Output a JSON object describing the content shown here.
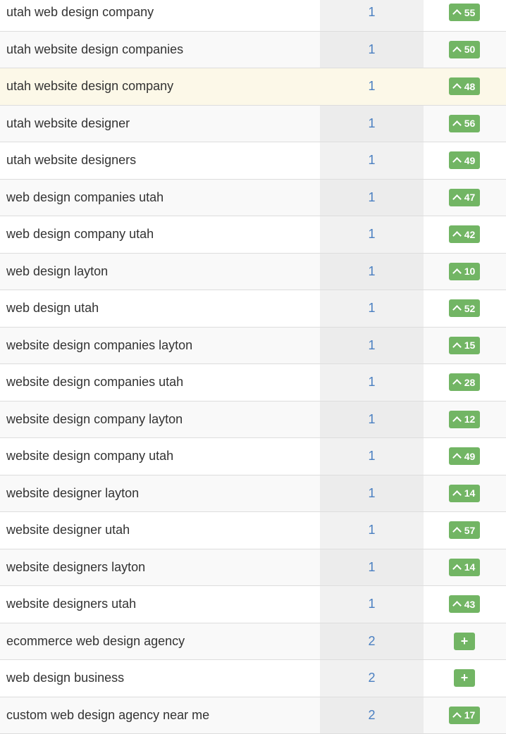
{
  "rows": [
    {
      "keyword": "utah web design company",
      "position": "1",
      "change": "55",
      "type": "up"
    },
    {
      "keyword": "utah website design companies",
      "position": "1",
      "change": "50",
      "type": "up"
    },
    {
      "keyword": "utah website design company",
      "position": "1",
      "change": "48",
      "type": "up",
      "highlighted": true
    },
    {
      "keyword": "utah website designer",
      "position": "1",
      "change": "56",
      "type": "up"
    },
    {
      "keyword": "utah website designers",
      "position": "1",
      "change": "49",
      "type": "up"
    },
    {
      "keyword": "web design companies utah",
      "position": "1",
      "change": "47",
      "type": "up"
    },
    {
      "keyword": "web design company utah",
      "position": "1",
      "change": "42",
      "type": "up"
    },
    {
      "keyword": "web design layton",
      "position": "1",
      "change": "10",
      "type": "up"
    },
    {
      "keyword": "web design utah",
      "position": "1",
      "change": "52",
      "type": "up"
    },
    {
      "keyword": "website design companies layton",
      "position": "1",
      "change": "15",
      "type": "up"
    },
    {
      "keyword": "website design companies utah",
      "position": "1",
      "change": "28",
      "type": "up"
    },
    {
      "keyword": "website design company layton",
      "position": "1",
      "change": "12",
      "type": "up"
    },
    {
      "keyword": "website design company utah",
      "position": "1",
      "change": "49",
      "type": "up"
    },
    {
      "keyword": "website designer layton",
      "position": "1",
      "change": "14",
      "type": "up"
    },
    {
      "keyword": "website designer utah",
      "position": "1",
      "change": "57",
      "type": "up"
    },
    {
      "keyword": "website designers layton",
      "position": "1",
      "change": "14",
      "type": "up"
    },
    {
      "keyword": "website designers utah",
      "position": "1",
      "change": "43",
      "type": "up"
    },
    {
      "keyword": "ecommerce web design agency",
      "position": "2",
      "change": "+",
      "type": "new"
    },
    {
      "keyword": "web design business",
      "position": "2",
      "change": "+",
      "type": "new"
    },
    {
      "keyword": "custom web design agency near me",
      "position": "2",
      "change": "17",
      "type": "up"
    }
  ],
  "colors": {
    "badge": "#72b564",
    "position": "#4a7fc1",
    "highlight": "#fcf8e8"
  }
}
